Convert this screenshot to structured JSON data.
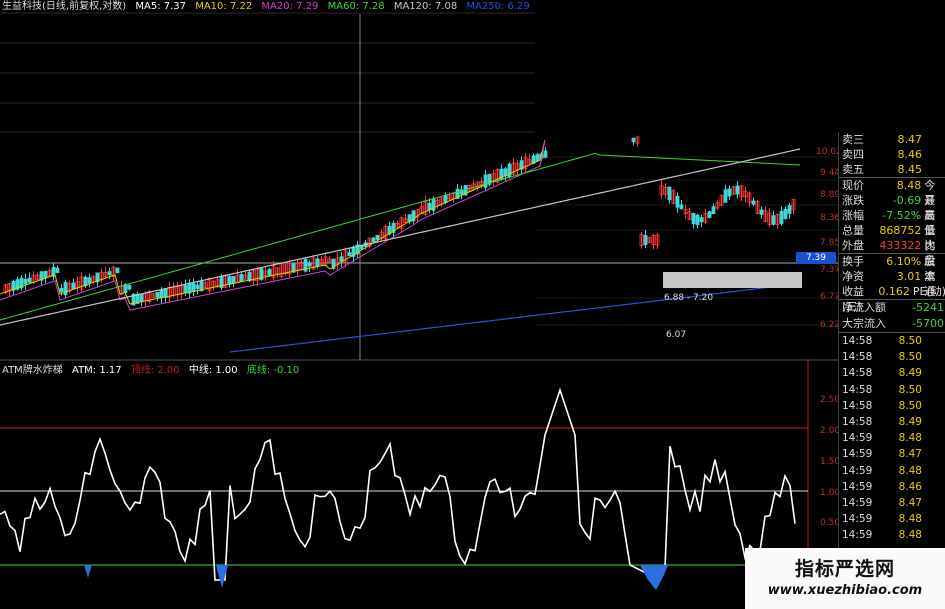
{
  "legend": {
    "title": "生益科技(日线,前复权,对数)",
    "ma5": "MA5: 7.37",
    "ma10": "MA10: 7.22",
    "ma20": "MA20: 7.29",
    "ma60": "MA60: 7.28",
    "ma120": "MA120: 7.08",
    "ma250": "MA250: 6.29"
  },
  "price_tag": "7.39",
  "annotations": {
    "range": "6.88 - 7.20",
    "low": "6.07"
  },
  "right_axis": [
    "10.02",
    "9.44",
    "8.89",
    "8.36",
    "7.85",
    "7.37",
    "6.77",
    "6.22"
  ],
  "indicator": {
    "name": "ATM牌水炸梯",
    "atm": "ATM: 1.17",
    "upper": "顶线: 2.00",
    "mid": "中线: 1.00",
    "lower": "底线: -0.10",
    "axis": [
      "2.50",
      "2.00",
      "1.50",
      "1.00",
      "0.50"
    ]
  },
  "quote": {
    "ask3": {
      "k": "卖三",
      "v": "8.47"
    },
    "ask4": {
      "k": "卖四",
      "v": "8.46"
    },
    "ask5": {
      "k": "卖五",
      "v": "8.45"
    },
    "current": {
      "k": "现价",
      "v": "8.48",
      "k2": "今开"
    },
    "change": {
      "k": "涨跌",
      "v": "-0.69",
      "k2": "最高"
    },
    "pct": {
      "k": "涨幅",
      "v": "-7.52%",
      "k2": "最低"
    },
    "volume": {
      "k": "总量",
      "v": "868752",
      "k2": "量比"
    },
    "outer": {
      "k": "外盘",
      "v": "433322",
      "k2": "内盘"
    },
    "turnover": {
      "k": "换手",
      "v": "6.10%",
      "k2": "股本"
    },
    "netasset": {
      "k": "净资",
      "v": "3.01",
      "k2": "流通"
    },
    "eps": {
      "k": "收益(三)",
      "v": "0.162",
      "k2": "PE(动)"
    },
    "netflow": {
      "k": "净流入额",
      "v": "-5241"
    },
    "bigflow": {
      "k": "大宗流入",
      "v": "-5700"
    }
  },
  "ticks": [
    {
      "t": "14:58",
      "p": "8.50"
    },
    {
      "t": "14:58",
      "p": "8.50"
    },
    {
      "t": "14:58",
      "p": "8.49"
    },
    {
      "t": "14:58",
      "p": "8.50"
    },
    {
      "t": "14:58",
      "p": "8.50"
    },
    {
      "t": "14:58",
      "p": "8.49"
    },
    {
      "t": "14:59",
      "p": "8.48"
    },
    {
      "t": "14:59",
      "p": "8.47"
    },
    {
      "t": "14:59",
      "p": "8.48"
    },
    {
      "t": "14:59",
      "p": "8.46"
    },
    {
      "t": "14:59",
      "p": "8.47"
    },
    {
      "t": "14:59",
      "p": "8.48"
    },
    {
      "t": "14:59",
      "p": "8.48"
    }
  ],
  "watermark": {
    "cn": "指标严选网",
    "url": "www.xuezhibiao.com"
  },
  "colors": {
    "up": "#ff3a3a",
    "down": "#3ad8d8",
    "ma5": "#ffffff",
    "ma10": "#e6d000",
    "ma20": "#d040d0",
    "ma60": "#3ad83a",
    "ma120": "#c8c8c8",
    "ma250": "#2a50e0",
    "indicator": "#ffffff",
    "red_line": "#c02020"
  }
}
